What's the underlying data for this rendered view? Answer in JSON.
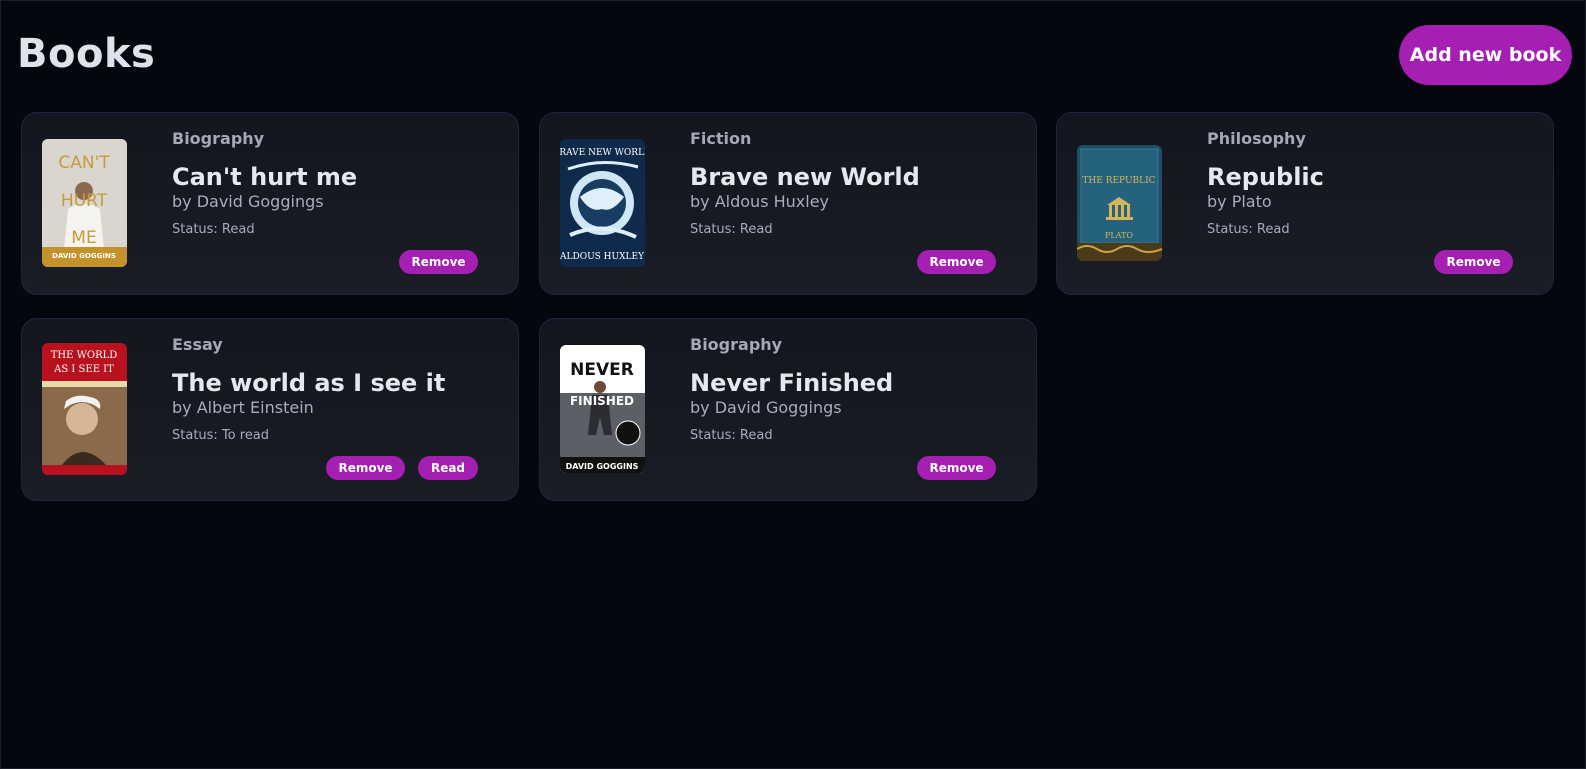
{
  "header": {
    "title": "Books",
    "add_button_label": "Add new book"
  },
  "colors": {
    "accent": "#a41fb2",
    "background": "#05070f",
    "card_border": "#2c1f3e"
  },
  "books": [
    {
      "genre": "Biography",
      "title": "Can't hurt me",
      "author": "by David Goggings",
      "status": "Status: Read",
      "remove_label": "Remove",
      "cover": {
        "line1": "CAN'T",
        "line2": "HURT",
        "line3": "ME",
        "footer": "DAVID GOGGINS"
      }
    },
    {
      "genre": "Fiction",
      "title": "Brave new World",
      "author": "by Aldous Huxley",
      "status": "Status: Read",
      "remove_label": "Remove",
      "cover": {
        "top": "BRAVE NEW WORLD",
        "bottom": "ALDOUS HUXLEY"
      }
    },
    {
      "genre": "Philosophy",
      "title": "Republic",
      "author": "by Plato",
      "status": "Status: Read",
      "remove_label": "Remove",
      "cover": {
        "top": "THE REPUBLIC",
        "bottom": "PLATO"
      }
    },
    {
      "genre": "Essay",
      "title": "The world as I see it",
      "author": "by Albert Einstein",
      "status": "Status: To read",
      "remove_label": "Remove",
      "read_label": "Read",
      "cover": {
        "line1": "THE WORLD",
        "line2": "AS I SEE IT"
      }
    },
    {
      "genre": "Biography",
      "title": "Never Finished",
      "author": "by David Goggings",
      "status": "Status: Read",
      "remove_label": "Remove",
      "cover": {
        "line1": "NEVER",
        "line2": "FINISHED",
        "footer": "DAVID GOGGINS"
      }
    }
  ]
}
